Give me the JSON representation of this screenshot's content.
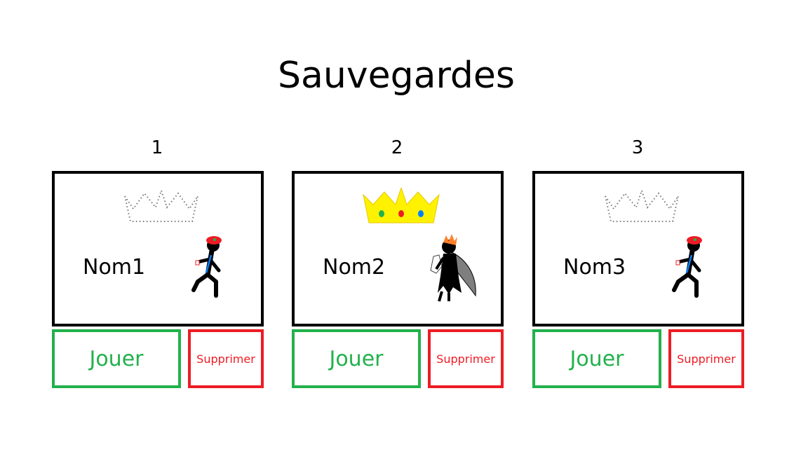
{
  "title": "Sauvegardes",
  "colors": {
    "play": "#22b14c",
    "delete": "#ed1c24",
    "crown_gold": "#fff200"
  },
  "slots": [
    {
      "number": "1",
      "name": "Nom1",
      "crown": "empty-crown-outline",
      "character": "runner-red-cap",
      "play_label": "Jouer",
      "delete_label": "Supprimer"
    },
    {
      "number": "2",
      "name": "Nom2",
      "crown": "gold-crown",
      "character": "dark-winged-warrior",
      "play_label": "Jouer",
      "delete_label": "Supprimer"
    },
    {
      "number": "3",
      "name": "Nom3",
      "crown": "empty-crown-outline",
      "character": "runner-red-cap",
      "play_label": "Jouer",
      "delete_label": "Supprimer"
    }
  ]
}
